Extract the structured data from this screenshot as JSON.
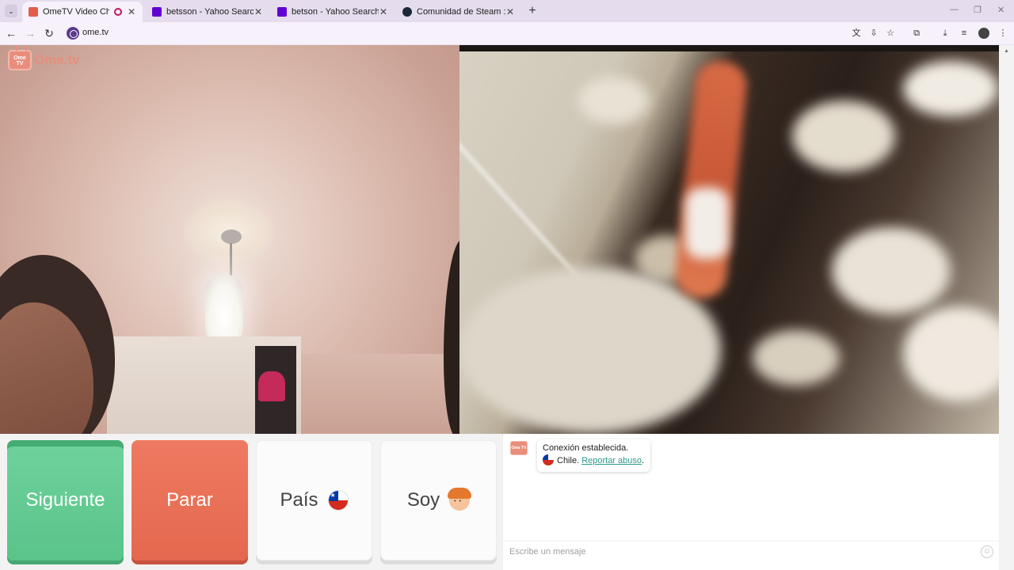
{
  "browser": {
    "tabs": [
      {
        "title": "OmeTV Video Chat — Ome",
        "active": true,
        "favicon": "ometv-favicon",
        "recording": true
      },
      {
        "title": "betsson - Yahoo Search Tus resu",
        "active": false,
        "favicon": "yahoo-favicon"
      },
      {
        "title": "betson - Yahoo Search Tus resu",
        "active": false,
        "favicon": "yahoo-favicon"
      },
      {
        "title": "Comunidad de Steam :: João",
        "active": false,
        "favicon": "steam-favicon"
      }
    ],
    "url": "ome.tv",
    "tab_close_glyph": "✕",
    "new_tab_glyph": "+"
  },
  "app": {
    "logo_badge": "Ome TV",
    "logo_text": "Ome.tv"
  },
  "controls": {
    "next_label": "Siguiente",
    "stop_label": "Parar",
    "country_label": "País",
    "gender_label": "Soy"
  },
  "chat": {
    "logo_badge": "Ome TV",
    "status": "Conexión establecida.",
    "country": "Chile.",
    "report_link": "Reportar abuso",
    "placeholder": "Escribe un mensaje"
  },
  "colors": {
    "next": "#5ac489",
    "stop": "#e4684f",
    "brand": "#e98d7c",
    "link": "#2e9a8a"
  }
}
